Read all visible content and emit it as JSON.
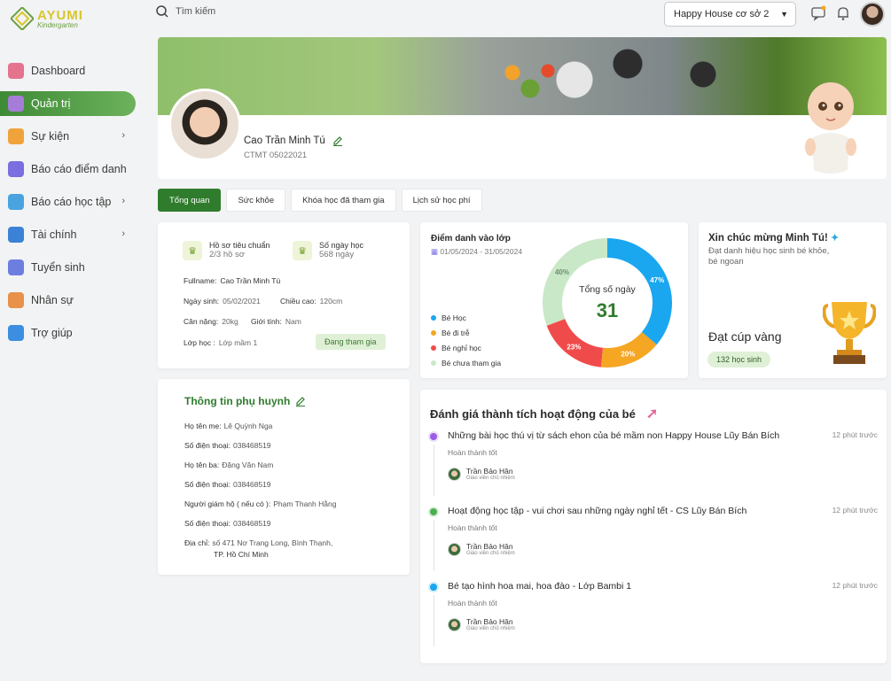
{
  "brand": {
    "name": "AYUMI",
    "sub": "Kindergarten"
  },
  "sidebar": {
    "items": [
      {
        "label": "Dashboard",
        "icon": "dashboard-icon",
        "color": "#e5738e",
        "chevron": false,
        "active": false
      },
      {
        "label": "Quản trị",
        "icon": "admin-icon",
        "color": "#a57dd8",
        "chevron": false,
        "active": true
      },
      {
        "label": "Sự kiện",
        "icon": "event-icon",
        "color": "#f0a33b",
        "chevron": true,
        "active": false
      },
      {
        "label": "Báo cáo điểm danh",
        "icon": "attendance-report-icon",
        "color": "#7b6ee0",
        "chevron": false,
        "active": false
      },
      {
        "label": "Báo cáo học tập",
        "icon": "study-report-icon",
        "color": "#4aa3df",
        "chevron": true,
        "active": false
      },
      {
        "label": "Tài chính",
        "icon": "finance-icon",
        "color": "#3b82d6",
        "chevron": true,
        "active": false
      },
      {
        "label": "Tuyển sinh",
        "icon": "enrollment-icon",
        "color": "#6c7fe0",
        "chevron": false,
        "active": false
      },
      {
        "label": "Nhân sự",
        "icon": "staff-icon",
        "color": "#e8914a",
        "chevron": false,
        "active": false
      },
      {
        "label": "Trợ giúp",
        "icon": "help-icon",
        "color": "#3b8ee0",
        "chevron": false,
        "active": false
      }
    ]
  },
  "topbar": {
    "search_placeholder": "Tìm kiếm",
    "branch": "Happy House cơ sở 2"
  },
  "profile": {
    "name": "Cao Trần Minh Tú",
    "code": "CTMT 05022021"
  },
  "tabs": [
    "Tổng quan",
    "Sức khỏe",
    "Khóa học đã tham gia",
    "Lịch sử học phí"
  ],
  "info": {
    "stat1_label": "Hồ sơ tiêu chuẩn",
    "stat1_value": "2/3 hồ sơ",
    "stat2_label": "Số ngày học",
    "stat2_value": "568 ngày",
    "fullname_label": "Fullname:",
    "fullname": "Cao Trần Minh Tú",
    "dob_label": "Ngày sinh:",
    "dob": "05/02/2021",
    "height_label": "Chiều cao:",
    "height": "120cm",
    "weight_label": "Cân nặng:",
    "weight": "20kg",
    "gender_label": "Giới tính:",
    "gender": "Nam",
    "class_label": "Lớp học :",
    "class": "Lớp mầm 1",
    "status": "Đang tham gia"
  },
  "parent": {
    "title": "Thông tin phụ huynh",
    "mother_label": "Họ tên mẹ:",
    "mother": "Lê Quỳnh Nga",
    "phone1_label": "Số điện thoại:",
    "phone1": "038468519",
    "father_label": "Họ tên ba:",
    "father": "Đặng Văn Nam",
    "phone2_label": "Số điện thoại:",
    "phone2": "038468519",
    "guardian_label": "Người giám hộ ( nếu có ):",
    "guardian": "Phạm Thanh Hằng",
    "phone3_label": "Số điện thoại:",
    "phone3": "038468519",
    "address_label": "Địa chỉ:",
    "address_line1": "số 471 Nơ Trang Long, Bình Thạnh,",
    "address_line2": "TP. Hồ Chí Minh"
  },
  "attendance": {
    "title": "Điểm danh vào lớp",
    "range": "01/05/2024 - 31/05/2024",
    "center_label": "Tổng số ngày",
    "center_value": "31",
    "legend": [
      {
        "label": "Bé Học",
        "color": "#1aa7f0"
      },
      {
        "label": "Bé đi trễ",
        "color": "#f5a623"
      },
      {
        "label": "Bé nghỉ học",
        "color": "#f04b4b"
      },
      {
        "label": "Bé chưa tham gia",
        "color": "#c9e8c8"
      }
    ],
    "slices": [
      {
        "label": "47%",
        "value": 47,
        "color": "#1aa7f0"
      },
      {
        "label": "20%",
        "value": 20,
        "color": "#f5a623"
      },
      {
        "label": "23%",
        "value": 23,
        "color": "#f04b4b"
      },
      {
        "label": "40%",
        "value": 40,
        "color": "#c9e8c8"
      }
    ]
  },
  "congrats": {
    "title": "Xin chúc mừng Minh Tú!",
    "subtitle": "Đạt danh hiệu học sinh bé khỏe, bé ngoan",
    "award": "Đạt cúp vàng",
    "count": "132 học sinh"
  },
  "achievements": {
    "title": "Đánh giá thành tích hoạt động của bé",
    "items": [
      {
        "title": "Những bài học thú vị từ sách ehon của bé mầm non Happy House Lũy Bán Bích",
        "time": "12 phút trước",
        "status": "Hoàn thành tốt",
        "teacher": "Trần Bảo Hân",
        "role": "Giáo viên chủ nhiệm",
        "dot": "#9b5ce6"
      },
      {
        "title": "Hoạt động học tập - vui chơi sau những ngày nghỉ tết - CS Lũy Bán Bích",
        "time": "12 phút trước",
        "status": "Hoàn thành tốt",
        "teacher": "Trần Bảo Hân",
        "role": "Giáo viên chủ nhiệm",
        "dot": "#4caf50"
      },
      {
        "title": "Bé tạo hình hoa mai, hoa đào - Lớp Bambi 1",
        "time": "12 phút trước",
        "status": "Hoàn thành tốt",
        "teacher": "Trần Bảo Hân",
        "role": "Giáo viên chủ nhiệm",
        "dot": "#1aa7f0"
      }
    ]
  }
}
